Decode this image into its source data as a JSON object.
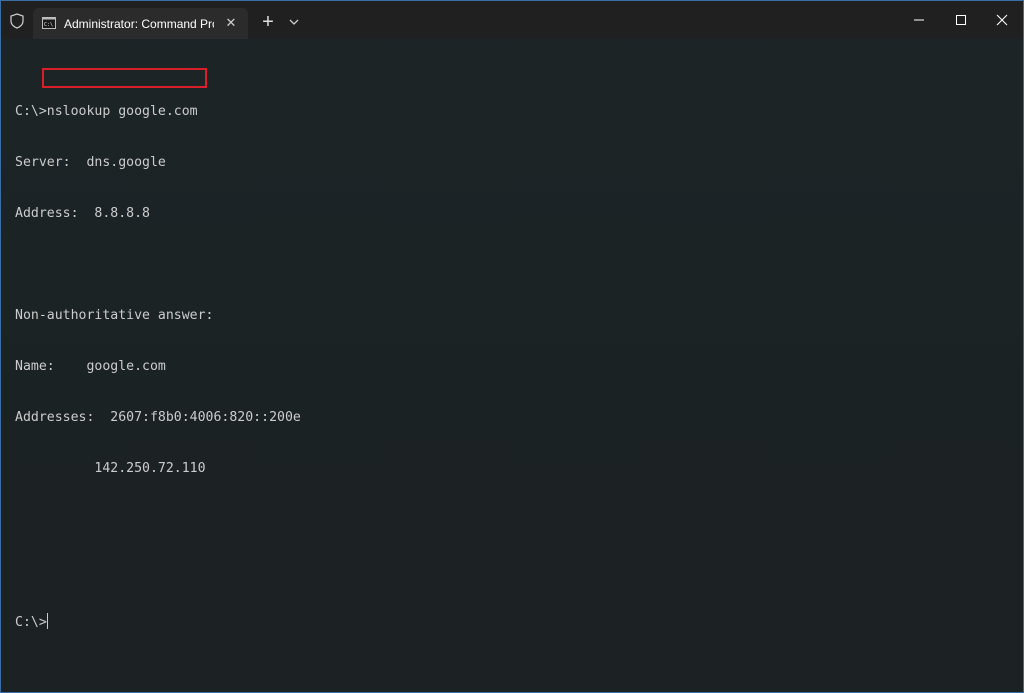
{
  "titlebar": {
    "tab_title": "Administrator: Command Prom",
    "shield_icon": "shield-icon",
    "tab_icon": "cmd-icon",
    "close_tab_icon": "close-icon",
    "new_tab_icon": "plus-icon",
    "dropdown_icon": "chevron-down-icon"
  },
  "window_controls": {
    "minimize": "minimize-icon",
    "maximize": "maximize-icon",
    "close": "close-icon"
  },
  "terminal": {
    "prompt_1": "C:\\>",
    "command": "nslookup google.com",
    "server_line": "Server:  dns.google",
    "address_line": "Address:  8.8.8.8",
    "blank": "",
    "nonauth_line": "Non-authoritative answer:",
    "name_line": "Name:    google.com",
    "addresses_line": "Addresses:  2607:f8b0:4006:820::200e",
    "ipv4_line": "          142.250.72.110",
    "prompt_2": "C:\\>"
  },
  "colors": {
    "highlight_border": "#d9202a",
    "terminal_text": "#cccccc",
    "titlebar_bg": "#202020"
  }
}
